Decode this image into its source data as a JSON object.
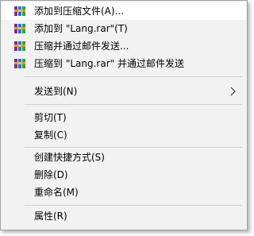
{
  "menu": {
    "items": [
      {
        "label": "添加到压缩文件(A)...",
        "icon": "winrar-icon",
        "name": "add-to-archive"
      },
      {
        "label": "添加到 \"Lang.rar\"(T)",
        "icon": "winrar-icon",
        "name": "add-to-lang-rar"
      },
      {
        "label": "压缩并通过邮件发送...",
        "icon": "winrar-icon",
        "name": "compress-and-email"
      },
      {
        "label": "压缩到 \"Lang.rar\" 并通过邮件发送",
        "icon": "winrar-icon",
        "name": "compress-to-lang-rar-and-email"
      },
      {
        "label": "发送到(N)",
        "name": "send-to",
        "submenu": true
      },
      {
        "label": "剪切(T)",
        "name": "cut"
      },
      {
        "label": "复制(C)",
        "name": "copy"
      },
      {
        "label": "创建快捷方式(S)",
        "name": "create-shortcut"
      },
      {
        "label": "删除(D)",
        "name": "delete"
      },
      {
        "label": "重命名(M)",
        "name": "rename"
      },
      {
        "label": "属性(R)",
        "name": "properties"
      }
    ]
  }
}
